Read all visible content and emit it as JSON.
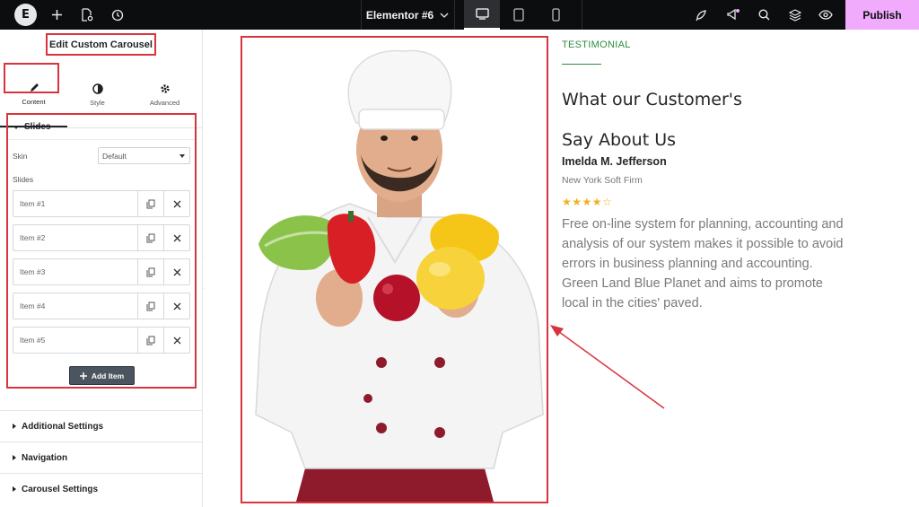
{
  "topbar": {
    "document_title": "Elementor #6",
    "publish_label": "Publish",
    "logo_text": "E"
  },
  "panel": {
    "title": "Edit Custom Carousel",
    "tabs": [
      {
        "label": "Content",
        "icon": "pencil-icon",
        "active": true
      },
      {
        "label": "Style",
        "icon": "half-circle-icon",
        "active": false
      },
      {
        "label": "Advanced",
        "icon": "gear-icon",
        "active": false
      }
    ],
    "slides_section": {
      "title": "Slides",
      "skin_label": "Skin",
      "skin_value": "Default",
      "slides_label": "Slides",
      "items": [
        "Item #1",
        "Item #2",
        "Item #3",
        "Item #4",
        "Item #5"
      ],
      "add_label": "Add Item"
    },
    "collapsed_sections": [
      "Additional Settings",
      "Navigation",
      "Carousel Settings"
    ]
  },
  "testimonial": {
    "eyebrow": "TESTIMONIAL",
    "heading_line1": "What our Customer's",
    "heading_line2": "Say About Us",
    "name": "Imelda M. Jefferson",
    "company": "New York Soft Firm",
    "rating": 4,
    "rating_max": 5,
    "stars_text": "★★★★☆",
    "body": "Free on-line system for planning, accounting and analysis of our system makes it possible to avoid errors in business planning and accounting. Green Land Blue Planet and aims to promote local  in the cities' paved."
  },
  "colors": {
    "highlight": "#d9343d",
    "accent_green": "#2e8b3e",
    "publish_bg": "#f0abfc",
    "topbar_bg": "#0c0d0e",
    "star": "#f2b01e"
  }
}
